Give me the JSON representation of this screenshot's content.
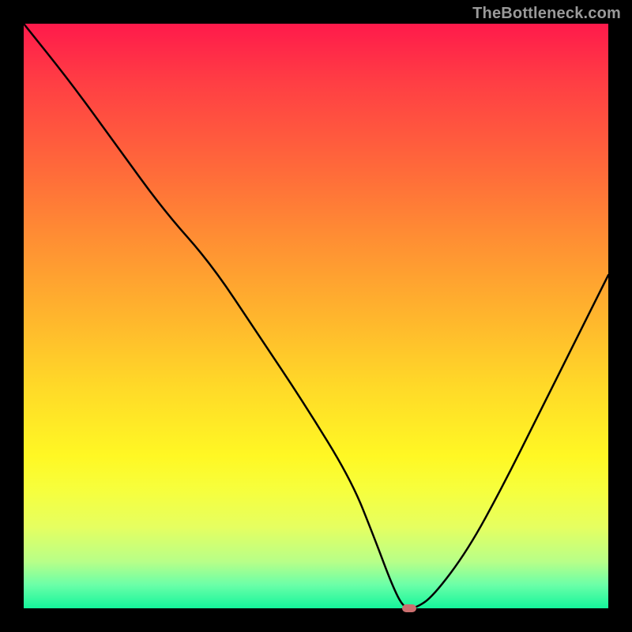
{
  "watermark": "TheBottleneck.com",
  "accent_marker_color": "#cc6f6f",
  "chart_data": {
    "type": "line",
    "title": "",
    "xlabel": "",
    "ylabel": "",
    "xlim": [
      0,
      100
    ],
    "ylim": [
      0,
      100
    ],
    "grid": false,
    "legend": false,
    "background": "vertical-gradient red→orange→yellow→green, black frame",
    "series": [
      {
        "name": "bottleneck-curve",
        "x": [
          0,
          8,
          16,
          24,
          32,
          40,
          48,
          56,
          60,
          63,
          65,
          67,
          70,
          76,
          82,
          88,
          94,
          100
        ],
        "values": [
          100,
          90,
          79,
          68,
          59,
          47,
          35,
          22,
          12,
          4,
          0,
          0,
          2,
          10,
          21,
          33,
          45,
          57
        ]
      }
    ],
    "annotations": [
      {
        "name": "minimum-marker",
        "x": 66,
        "y": 0,
        "shape": "rounded-rect",
        "color": "#cc6f6f"
      }
    ]
  }
}
